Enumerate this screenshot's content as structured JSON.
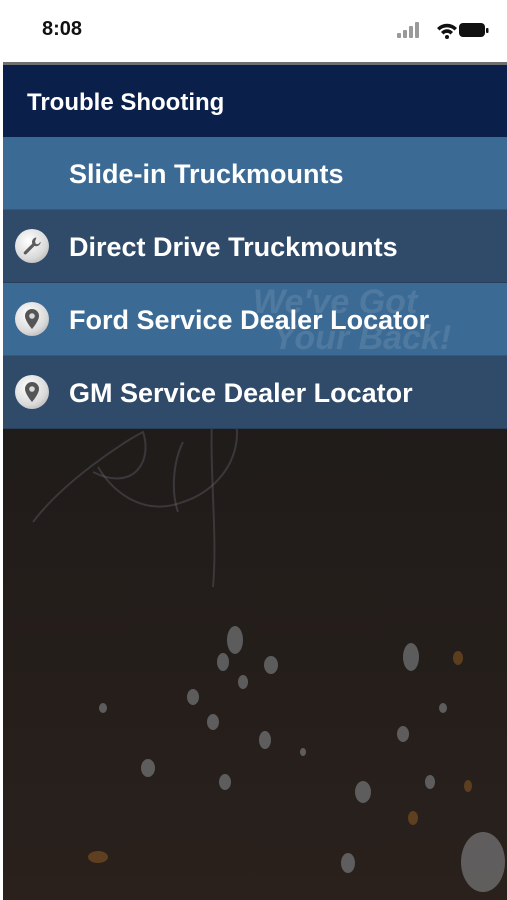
{
  "status_bar": {
    "time": "8:08",
    "icons": [
      "signal-icon",
      "wifi-icon",
      "battery-icon"
    ]
  },
  "header": {
    "title": "Trouble Shooting"
  },
  "menu": {
    "items": [
      {
        "label": "Slide-in Truckmounts",
        "icon": "",
        "bg": "#3b6a94"
      },
      {
        "label": "Direct Drive Truckmounts",
        "icon": "wrench-icon",
        "bg": "#2f4b69"
      },
      {
        "label": "Ford Service Dealer Locator",
        "icon": "location-pin-icon",
        "bg": "#3b6a94"
      },
      {
        "label": "GM Service Dealer Locator",
        "icon": "location-pin-icon",
        "bg": "#2f4b69"
      }
    ]
  },
  "watermark": {
    "line1": "We've Got",
    "line2": "Your Back!"
  },
  "colors": {
    "header_bg": "#0a1f4a",
    "item_light": "#3b6a94",
    "item_dark": "#2f4b69",
    "screen_bg": "#211c1b"
  }
}
